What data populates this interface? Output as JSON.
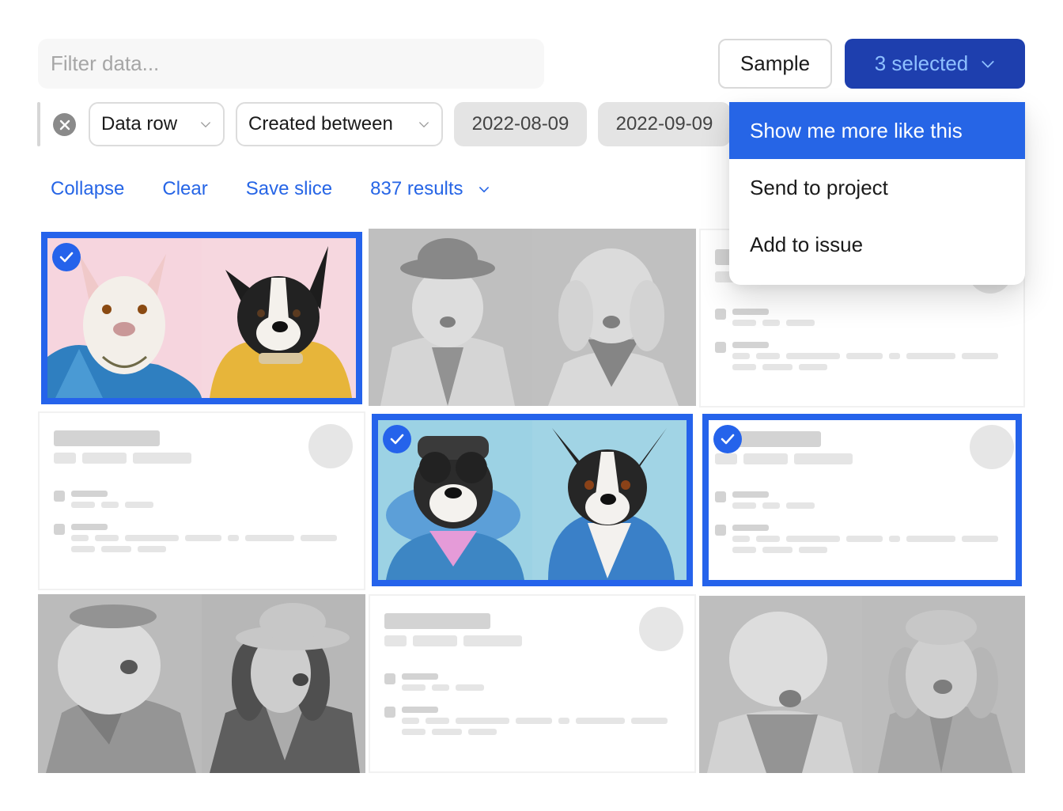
{
  "toolbar": {
    "filter_placeholder": "Filter data...",
    "filter_value": "",
    "sample_label": "Sample",
    "selected_label": "3 selected",
    "selected_count": 3
  },
  "filter": {
    "field_label": "Data row",
    "operator_label": "Created between",
    "date_from": "2022-08-09",
    "date_to": "2022-09-09"
  },
  "actions": {
    "collapse_label": "Collapse",
    "clear_label": "Clear",
    "save_slice_label": "Save slice",
    "results_label": "837 results"
  },
  "menu": {
    "items": [
      {
        "label": "Show me more like this",
        "active": true
      },
      {
        "label": "Send to project",
        "active": false
      },
      {
        "label": "Add to issue",
        "active": false
      }
    ]
  },
  "grid": {
    "tiles": [
      {
        "kind": "image",
        "selected": true,
        "subject": "white french bulldog in blue jacket and boston terrier in yellow hoodie, pink background",
        "grayscale": false
      },
      {
        "kind": "image",
        "selected": false,
        "subject": "terrier in hat and suit, poodle in plaid scarf",
        "grayscale": true
      },
      {
        "kind": "card",
        "selected": false,
        "subject": "data row placeholder card"
      },
      {
        "kind": "card",
        "selected": false,
        "subject": "data row placeholder card"
      },
      {
        "kind": "image",
        "selected": true,
        "subject": "boston terrier with goggles in blue fur jacket, boston terrier in blue hoodie, blue background",
        "grayscale": false
      },
      {
        "kind": "card",
        "selected": true,
        "subject": "data row placeholder card"
      },
      {
        "kind": "image",
        "selected": false,
        "subject": "fluffy dog in cap and coat, long-haired dog in fedora and trench coat",
        "grayscale": true
      },
      {
        "kind": "card",
        "selected": false,
        "subject": "data row placeholder card"
      },
      {
        "kind": "image",
        "selected": false,
        "subject": "poodle in scarf and vest, spaniel in beanie and tweed coat",
        "grayscale": true
      }
    ]
  },
  "colors": {
    "accent": "#2563eb",
    "primary_button": "#1e3fae",
    "primary_button_text": "#8ec0ff",
    "link": "#2665e6"
  }
}
